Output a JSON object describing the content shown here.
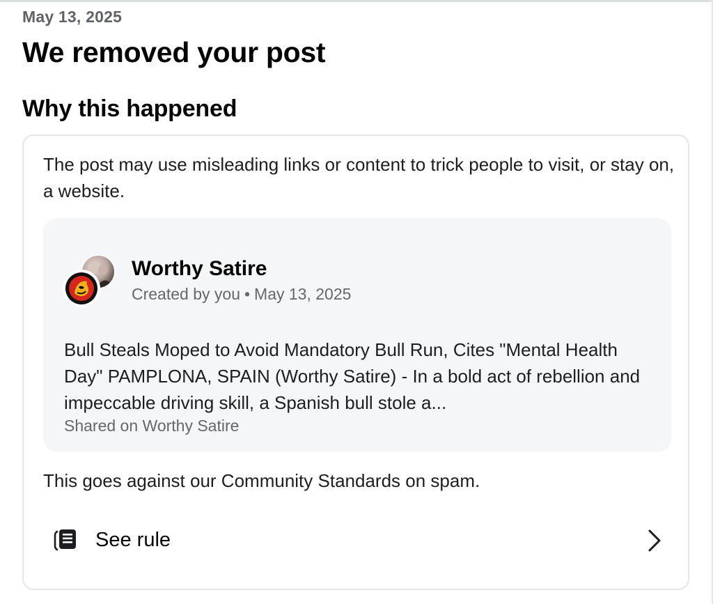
{
  "notice": {
    "date": "May 13, 2025",
    "title": "We removed your post"
  },
  "why": {
    "heading": "Why this happened",
    "reason": "The post may use misleading links or content to trick people to visit, or stay on, a website."
  },
  "post": {
    "author": "Worthy Satire",
    "created_by": "Created by you",
    "separator": "•",
    "date": "May 13, 2025",
    "body": "Bull Steals Moped to Avoid Mandatory Bull Run, Cites \"Mental Health Day\" PAMPLONA, SPAIN (Worthy Satire) - In a bold act of rebellion and impeccable driving skill, a Spanish bull stole a...",
    "source": "Shared on Worthy Satire"
  },
  "standards": {
    "text": "This goes against our Community Standards on spam."
  },
  "rule_link": {
    "label": "See rule",
    "icon": "book-icon",
    "chevron_icon": "chevron-right-icon"
  },
  "colors": {
    "primary_text": "#1c1e21",
    "secondary_text": "#65676b",
    "post_background": "#f5f6f8",
    "card_border": "#e4e6ea"
  }
}
